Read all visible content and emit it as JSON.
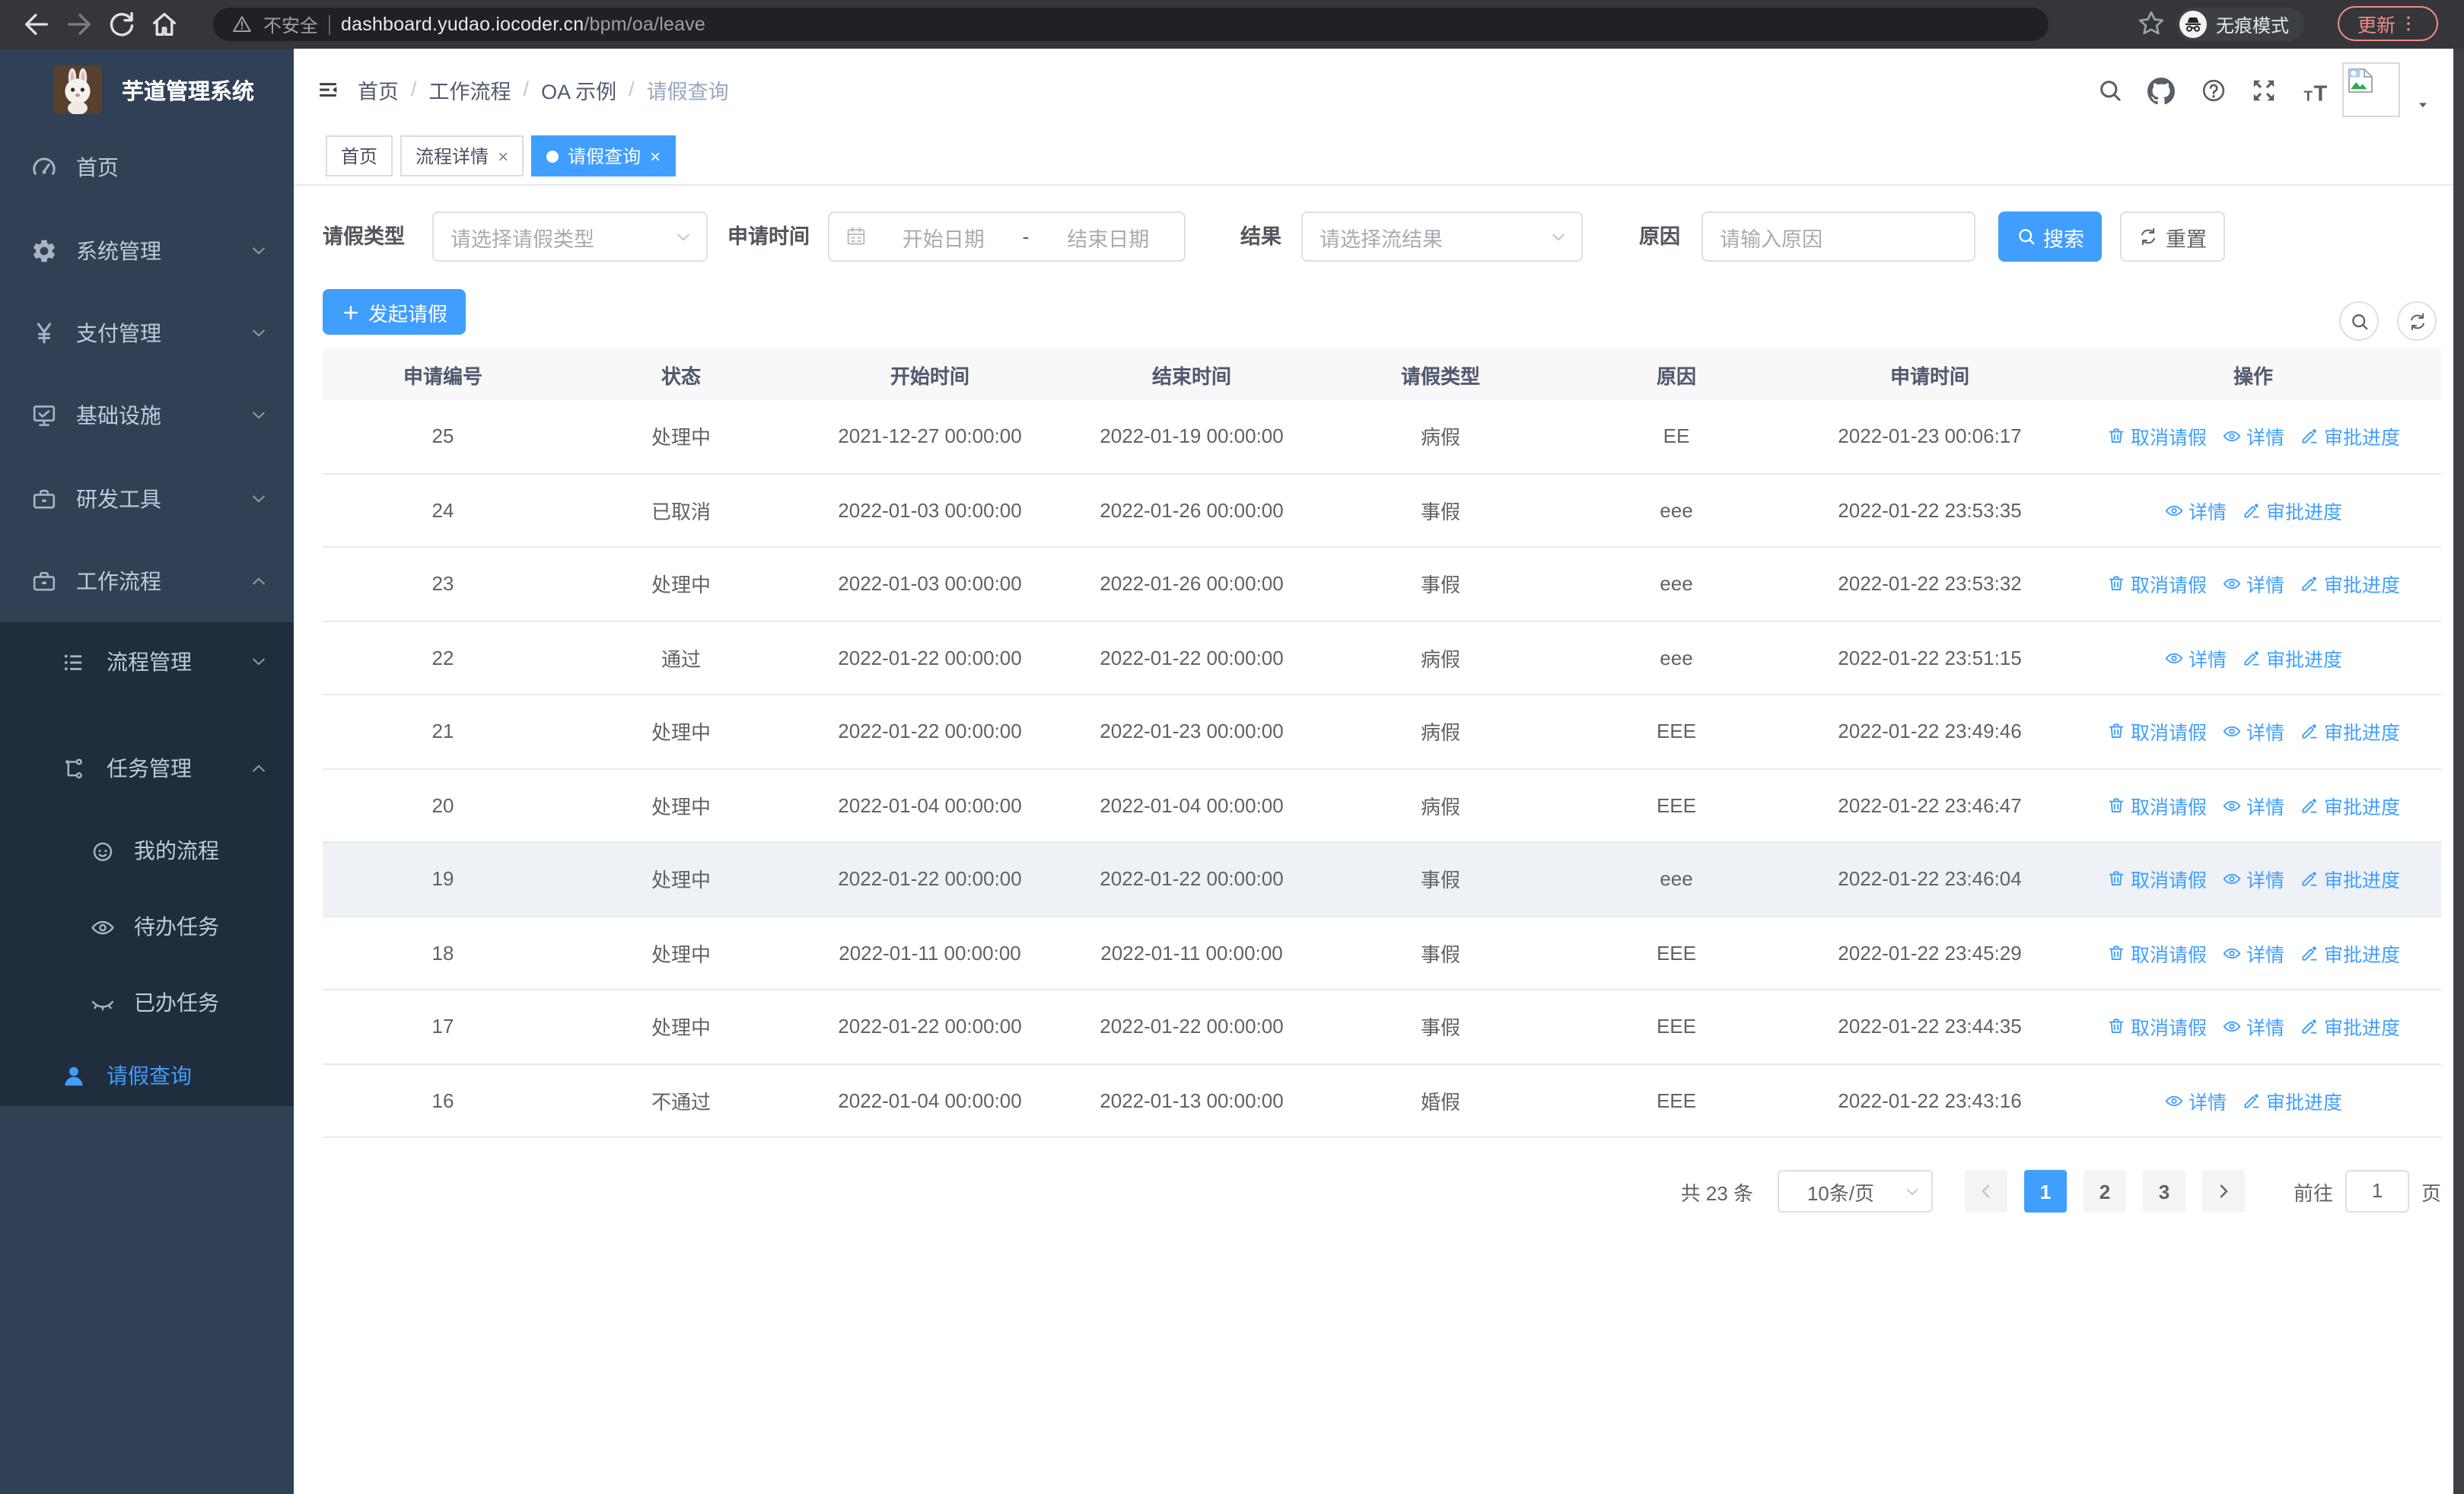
{
  "colors": {
    "accent": "#409eff",
    "update": "#f28b82",
    "sidebar_bg": "#304156",
    "submenu_bg": "#1f2d3d",
    "chrome_bg": "#35363a",
    "omnibox_bg": "#202124"
  },
  "browser": {
    "security_label": "不安全",
    "url_host": "dashboard.yudao.iocoder.cn",
    "url_path": "/bpm/oa/leave",
    "incognito_label": "无痕模式",
    "update_label": "更新"
  },
  "icons": {
    "back": "arrow-left",
    "forward": "arrow-right",
    "reload": "circular-arrow",
    "home": "house",
    "warning": "triangle-!",
    "star": "bookmark-star",
    "incognito": "hat-glasses",
    "menu": "3-dots",
    "logo": "rabbit-photo",
    "search": "magnifier",
    "github": "octocat",
    "help": "?-circle",
    "fullscreen": "4-arrows",
    "font-size": "tT",
    "avatar": "broken-image",
    "calendar": "calendar",
    "cancel": "trash",
    "detail": "eye",
    "progress": "pencil",
    "reset": "circular-arrows",
    "plus": "+"
  },
  "sidebar": {
    "app_title": "芋道管理系统",
    "items": [
      {
        "label": "首页",
        "icon": "gauge",
        "chevron": "none"
      },
      {
        "label": "系统管理",
        "icon": "gear",
        "chevron": "down"
      },
      {
        "label": "支付管理",
        "icon": "yen",
        "chevron": "down"
      },
      {
        "label": "基础设施",
        "icon": "monitor",
        "chevron": "down"
      },
      {
        "label": "研发工具",
        "icon": "briefcase",
        "chevron": "down"
      },
      {
        "label": "工作流程",
        "icon": "briefcase",
        "chevron": "up"
      }
    ],
    "submenu": [
      {
        "label": "流程管理",
        "icon": "listdots",
        "level": 2,
        "chevron": "down",
        "active": false
      },
      {
        "label": "任务管理",
        "icon": "flow",
        "level": 2,
        "chevron": "up",
        "active": false
      },
      {
        "label": "我的流程",
        "icon": "face",
        "level": 3,
        "chevron": "none",
        "active": false
      },
      {
        "label": "待办任务",
        "icon": "eye",
        "level": 3,
        "chevron": "none",
        "active": false
      },
      {
        "label": "已办任务",
        "icon": "eyeclosed",
        "level": 3,
        "chevron": "none",
        "active": false
      },
      {
        "label": "请假查询",
        "icon": "person",
        "level": 2,
        "chevron": "none",
        "active": true
      }
    ]
  },
  "header": {
    "breadcrumb": [
      "首页",
      "工作流程",
      "OA 示例",
      "请假查询"
    ]
  },
  "tabs": [
    {
      "label": "首页",
      "closable": false,
      "active": false
    },
    {
      "label": "流程详情",
      "closable": true,
      "active": false
    },
    {
      "label": "请假查询",
      "closable": true,
      "active": true
    }
  ],
  "filters": {
    "leave_type_label": "请假类型",
    "leave_type_placeholder": "请选择请假类型",
    "apply_time_label": "申请时间",
    "start_date_placeholder": "开始日期",
    "date_separator": "-",
    "end_date_placeholder": "结束日期",
    "result_label": "结果",
    "result_placeholder": "请选择流结果",
    "reason_label": "原因",
    "reason_placeholder": "请输入原因",
    "search_button": "搜索",
    "reset_button": "重置"
  },
  "toolbar": {
    "create_button": "发起请假"
  },
  "table": {
    "columns": [
      "申请编号",
      "状态",
      "开始时间",
      "结束时间",
      "请假类型",
      "原因",
      "申请时间",
      "操作"
    ],
    "action_labels": {
      "cancel": "取消请假",
      "detail": "详情",
      "progress": "审批进度"
    },
    "rows": [
      {
        "id": "25",
        "status": "处理中",
        "start": "2021-12-27 00:00:00",
        "end": "2022-01-19 00:00:00",
        "type": "病假",
        "reason": "EE",
        "applied": "2022-01-23 00:06:17",
        "actions": [
          "cancel",
          "detail",
          "progress"
        ],
        "highlight": false
      },
      {
        "id": "24",
        "status": "已取消",
        "start": "2022-01-03 00:00:00",
        "end": "2022-01-26 00:00:00",
        "type": "事假",
        "reason": "eee",
        "applied": "2022-01-22 23:53:35",
        "actions": [
          "detail",
          "progress"
        ],
        "highlight": false
      },
      {
        "id": "23",
        "status": "处理中",
        "start": "2022-01-03 00:00:00",
        "end": "2022-01-26 00:00:00",
        "type": "事假",
        "reason": "eee",
        "applied": "2022-01-22 23:53:32",
        "actions": [
          "cancel",
          "detail",
          "progress"
        ],
        "highlight": false
      },
      {
        "id": "22",
        "status": "通过",
        "start": "2022-01-22 00:00:00",
        "end": "2022-01-22 00:00:00",
        "type": "病假",
        "reason": "eee",
        "applied": "2022-01-22 23:51:15",
        "actions": [
          "detail",
          "progress"
        ],
        "highlight": false
      },
      {
        "id": "21",
        "status": "处理中",
        "start": "2022-01-22 00:00:00",
        "end": "2022-01-23 00:00:00",
        "type": "病假",
        "reason": "EEE",
        "applied": "2022-01-22 23:49:46",
        "actions": [
          "cancel",
          "detail",
          "progress"
        ],
        "highlight": false
      },
      {
        "id": "20",
        "status": "处理中",
        "start": "2022-01-04 00:00:00",
        "end": "2022-01-04 00:00:00",
        "type": "病假",
        "reason": "EEE",
        "applied": "2022-01-22 23:46:47",
        "actions": [
          "cancel",
          "detail",
          "progress"
        ],
        "highlight": false
      },
      {
        "id": "19",
        "status": "处理中",
        "start": "2022-01-22 00:00:00",
        "end": "2022-01-22 00:00:00",
        "type": "事假",
        "reason": "eee",
        "applied": "2022-01-22 23:46:04",
        "actions": [
          "cancel",
          "detail",
          "progress"
        ],
        "highlight": true
      },
      {
        "id": "18",
        "status": "处理中",
        "start": "2022-01-11 00:00:00",
        "end": "2022-01-11 00:00:00",
        "type": "事假",
        "reason": "EEE",
        "applied": "2022-01-22 23:45:29",
        "actions": [
          "cancel",
          "detail",
          "progress"
        ],
        "highlight": false
      },
      {
        "id": "17",
        "status": "处理中",
        "start": "2022-01-22 00:00:00",
        "end": "2022-01-22 00:00:00",
        "type": "事假",
        "reason": "EEE",
        "applied": "2022-01-22 23:44:35",
        "actions": [
          "cancel",
          "detail",
          "progress"
        ],
        "highlight": false
      },
      {
        "id": "16",
        "status": "不通过",
        "start": "2022-01-04 00:00:00",
        "end": "2022-01-13 00:00:00",
        "type": "婚假",
        "reason": "EEE",
        "applied": "2022-01-22 23:43:16",
        "actions": [
          "detail",
          "progress"
        ],
        "highlight": false
      }
    ]
  },
  "pagination": {
    "total": "共 23 条",
    "page_size": "10条/页",
    "pages": [
      "1",
      "2",
      "3"
    ],
    "active_page": "1",
    "goto_label": "前往",
    "goto_value": "1",
    "page_label": "页"
  }
}
